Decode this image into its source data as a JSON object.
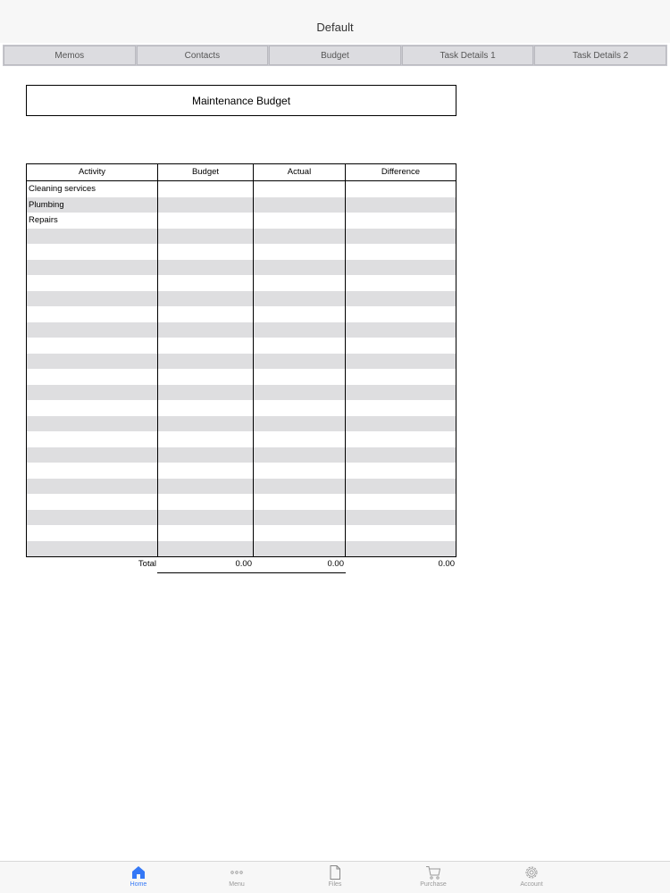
{
  "title": "Default",
  "tabs": [
    "Memos",
    "Contacts",
    "Budget",
    "Task Details 1",
    "Task Details 2"
  ],
  "sheet": {
    "title": "Maintenance Budget",
    "columns": [
      "Activity",
      "Budget",
      "Actual",
      "Difference"
    ],
    "rows": [
      [
        "Cleaning services",
        "",
        "",
        ""
      ],
      [
        "Plumbing",
        "",
        "",
        ""
      ],
      [
        "Repairs",
        "",
        "",
        ""
      ],
      [
        "",
        "",
        "",
        ""
      ],
      [
        "",
        "",
        "",
        ""
      ],
      [
        "",
        "",
        "",
        ""
      ],
      [
        "",
        "",
        "",
        ""
      ],
      [
        "",
        "",
        "",
        ""
      ],
      [
        "",
        "",
        "",
        ""
      ],
      [
        "",
        "",
        "",
        ""
      ],
      [
        "",
        "",
        "",
        ""
      ],
      [
        "",
        "",
        "",
        ""
      ],
      [
        "",
        "",
        "",
        ""
      ],
      [
        "",
        "",
        "",
        ""
      ],
      [
        "",
        "",
        "",
        ""
      ],
      [
        "",
        "",
        "",
        ""
      ],
      [
        "",
        "",
        "",
        ""
      ],
      [
        "",
        "",
        "",
        ""
      ],
      [
        "",
        "",
        "",
        ""
      ],
      [
        "",
        "",
        "",
        ""
      ],
      [
        "",
        "",
        "",
        ""
      ],
      [
        "",
        "",
        "",
        ""
      ],
      [
        "",
        "",
        "",
        ""
      ],
      [
        "",
        "",
        "",
        ""
      ]
    ],
    "totals": {
      "label": "Total",
      "budget": "0.00",
      "actual": "0.00",
      "difference": "0.00"
    }
  },
  "bottom_nav": [
    {
      "label": "Home",
      "icon": "home-icon",
      "active": true
    },
    {
      "label": "Menu",
      "icon": "more-dots-icon",
      "active": false
    },
    {
      "label": "Files",
      "icon": "file-icon",
      "active": false
    },
    {
      "label": "Purchase",
      "icon": "cart-icon",
      "active": false
    },
    {
      "label": "Account",
      "icon": "gear-icon",
      "active": false
    }
  ],
  "colors": {
    "accent": "#3478f6",
    "row_shade": "#dedee0",
    "tab_bg": "#dcdce0"
  }
}
